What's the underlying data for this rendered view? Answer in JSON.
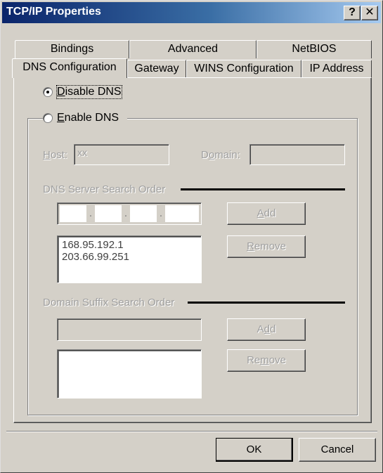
{
  "window": {
    "title": "TCP/IP Properties",
    "help_label": "?",
    "close_label": "✕"
  },
  "tabs": {
    "row_back": [
      {
        "label": "Bindings"
      },
      {
        "label": "Advanced"
      },
      {
        "label": "NetBIOS"
      }
    ],
    "row_front": [
      {
        "label": "DNS Configuration",
        "active": true
      },
      {
        "label": "Gateway"
      },
      {
        "label": "WINS Configuration"
      },
      {
        "label": "IP Address"
      }
    ]
  },
  "dns": {
    "disable_label": {
      "pre": "",
      "key": "D",
      "post": "isable DNS"
    },
    "enable_label": {
      "pre": "",
      "key": "E",
      "post": "nable DNS"
    },
    "selected": "disable",
    "host": {
      "label_key": "H",
      "label_post": "ost:",
      "value": "xx"
    },
    "domain": {
      "label_pre": "D",
      "label_key": "o",
      "label_post": "main:",
      "value": ""
    },
    "server_order": {
      "heading": "DNS Server Search Order",
      "ip_dots": [
        ".",
        ".",
        "."
      ],
      "entries": [
        "168.95.192.1",
        "203.66.99.251"
      ],
      "add": {
        "pre": "",
        "key": "A",
        "post": "dd"
      },
      "remove": {
        "pre": "",
        "key": "R",
        "post": "emove"
      }
    },
    "suffix_order": {
      "heading": "Domain Suffix Search Order",
      "add": {
        "pre": "A",
        "key": "d",
        "post": "d"
      },
      "remove": {
        "pre": "Re",
        "key": "m",
        "post": "ove"
      }
    }
  },
  "footer": {
    "ok_label": "OK",
    "cancel_label": "Cancel"
  },
  "colors": {
    "face": "#d4d0c8",
    "title_start": "#0a246a",
    "title_end": "#a6caf0"
  },
  "icons": {
    "help": "help-icon",
    "close": "close-icon"
  }
}
